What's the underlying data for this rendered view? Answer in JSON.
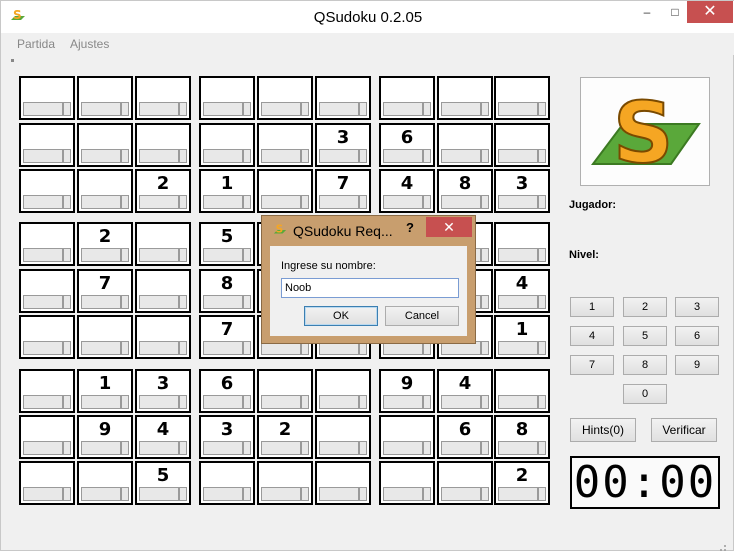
{
  "window": {
    "title": "QSudoku 0.2.05",
    "minimize": "–",
    "maximize": "□",
    "close": "✕"
  },
  "menu": {
    "items": [
      "Partida",
      "Ajustes"
    ]
  },
  "board": {
    "values": [
      [
        "",
        "",
        "",
        "",
        "",
        "",
        "",
        "",
        ""
      ],
      [
        "",
        "",
        "",
        "",
        "",
        "3",
        "6",
        "",
        ""
      ],
      [
        "",
        "",
        "2",
        "1",
        "",
        "7",
        "4",
        "8",
        "3"
      ],
      [
        "",
        "2",
        "",
        "5",
        "",
        "",
        "",
        "",
        ""
      ],
      [
        "",
        "7",
        "",
        "8",
        "",
        "",
        "",
        "",
        "4"
      ],
      [
        "",
        "",
        "",
        "7",
        "",
        "",
        "",
        "",
        "1"
      ],
      [
        "",
        "1",
        "3",
        "6",
        "",
        "",
        "9",
        "4",
        ""
      ],
      [
        "",
        "9",
        "4",
        "3",
        "2",
        "",
        "",
        "6",
        "8"
      ],
      [
        "",
        "",
        "5",
        "",
        "",
        "",
        "",
        "",
        "2"
      ]
    ]
  },
  "side": {
    "player_label": "Jugador:",
    "level_label": "Nivel:",
    "keypad": [
      "1",
      "2",
      "3",
      "4",
      "5",
      "6",
      "7",
      "8",
      "9",
      "0"
    ],
    "hints_label": "Hints(0)",
    "verify_label": "Verificar",
    "timer": "00:00"
  },
  "dialog": {
    "title": "QSudoku Req...",
    "help": "?",
    "close": "✕",
    "prompt": "Ingrese su nombre:",
    "name_value": "Noob",
    "ok_label": "OK",
    "cancel_label": "Cancel"
  },
  "colors": {
    "dialog_frame": "#c89e6e",
    "close_red": "#c75050",
    "logo_orange": "#f5a623",
    "logo_green": "#5aa83a"
  }
}
